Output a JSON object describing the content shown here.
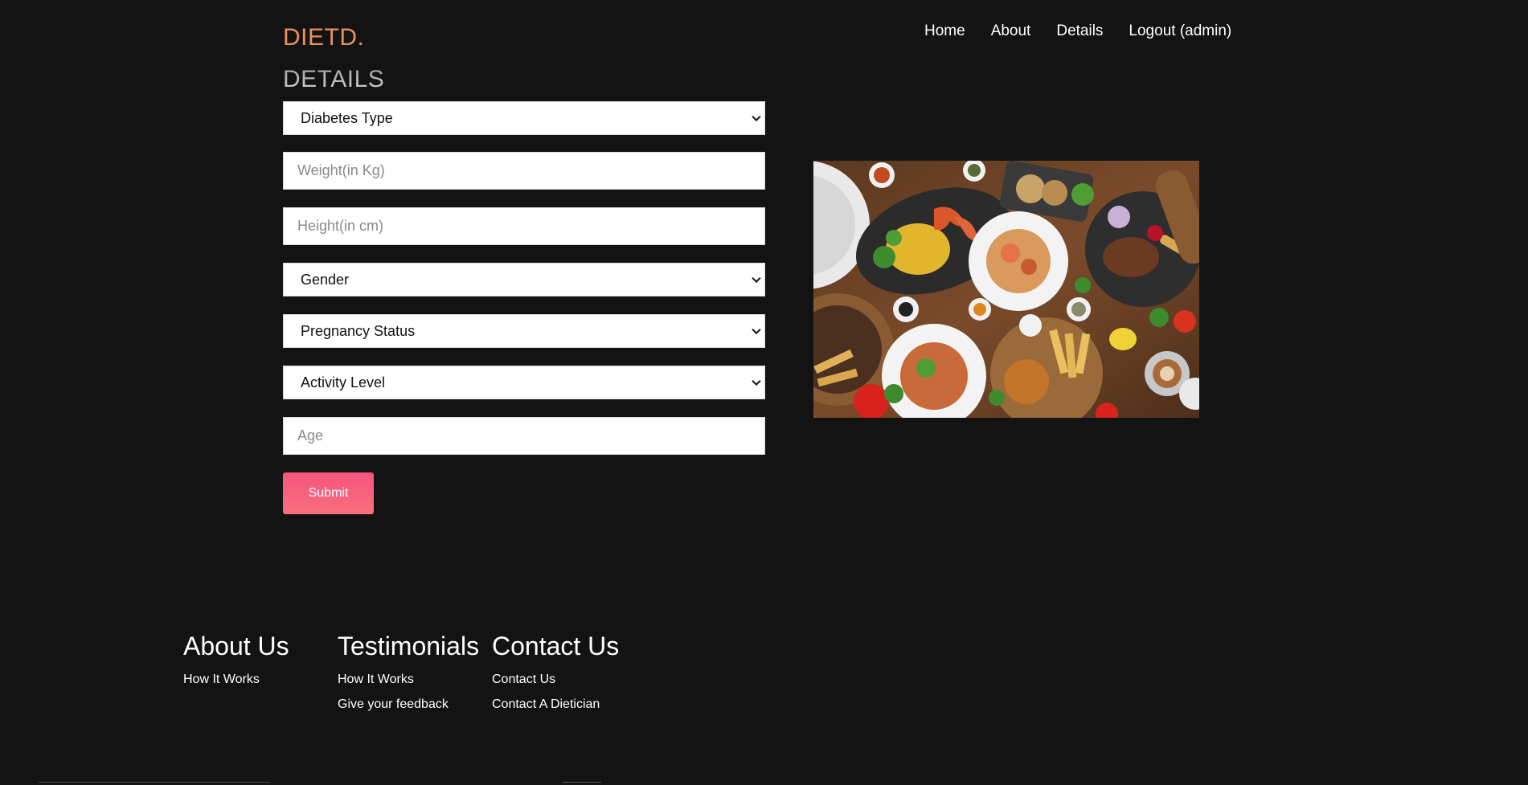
{
  "brand": {
    "logo": "DIETD."
  },
  "nav": [
    "Home",
    "About",
    "Details",
    "Logout (admin)"
  ],
  "form": {
    "title": "DETAILS",
    "diabetes_type": "Diabetes Type",
    "weight_placeholder": "Weight(in Kg)",
    "height_placeholder": "Height(in cm)",
    "gender": "Gender",
    "pregnancy_status": "Pregnancy Status",
    "activity_level": "Activity Level",
    "age_placeholder": "Age",
    "submit_label": "Submit"
  },
  "footer": {
    "about": {
      "heading": "About Us",
      "links": [
        "How It Works"
      ]
    },
    "testimonials": {
      "heading": "Testimonials",
      "links": [
        "How It Works",
        "Give your feedback"
      ]
    },
    "contact": {
      "heading": "Contact Us",
      "links": [
        "Contact Us",
        "Contact A Dietician"
      ]
    }
  },
  "colors": {
    "background": "#131313",
    "logo": "#ec8f5d",
    "submit": "#f5547e"
  }
}
